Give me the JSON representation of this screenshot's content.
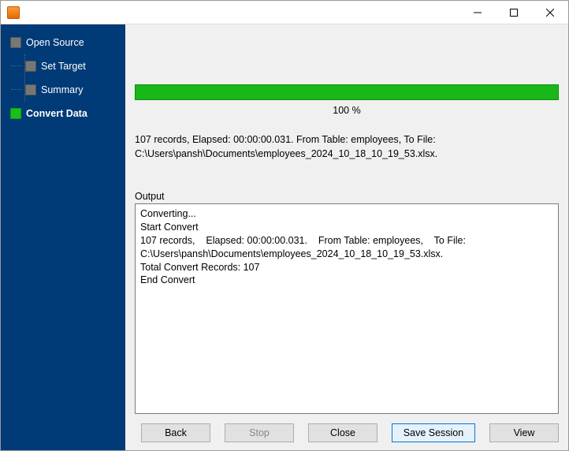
{
  "window": {
    "title": ""
  },
  "sidebar": {
    "items": [
      {
        "label": "Open Source",
        "active": false
      },
      {
        "label": "Set Target",
        "active": false
      },
      {
        "label": "Summary",
        "active": false
      },
      {
        "label": "Convert Data",
        "active": true
      }
    ]
  },
  "progress": {
    "percent_label": "100 %",
    "bar_fill": 100,
    "bar_color": "#18b818"
  },
  "status": {
    "line1": "107 records,    Elapsed: 00:00:00.031.    From Table: employees,    To File:",
    "line2": "C:\\Users\\pansh\\Documents\\employees_2024_10_18_10_19_53.xlsx."
  },
  "output": {
    "label": "Output",
    "text": "Converting...\nStart Convert\n107 records,    Elapsed: 00:00:00.031.    From Table: employees,    To File: C:\\Users\\pansh\\Documents\\employees_2024_10_18_10_19_53.xlsx.\nTotal Convert Records: 107\nEnd Convert"
  },
  "buttons": {
    "back": "Back",
    "stop": "Stop",
    "close": "Close",
    "save_session": "Save Session",
    "view": "View"
  }
}
